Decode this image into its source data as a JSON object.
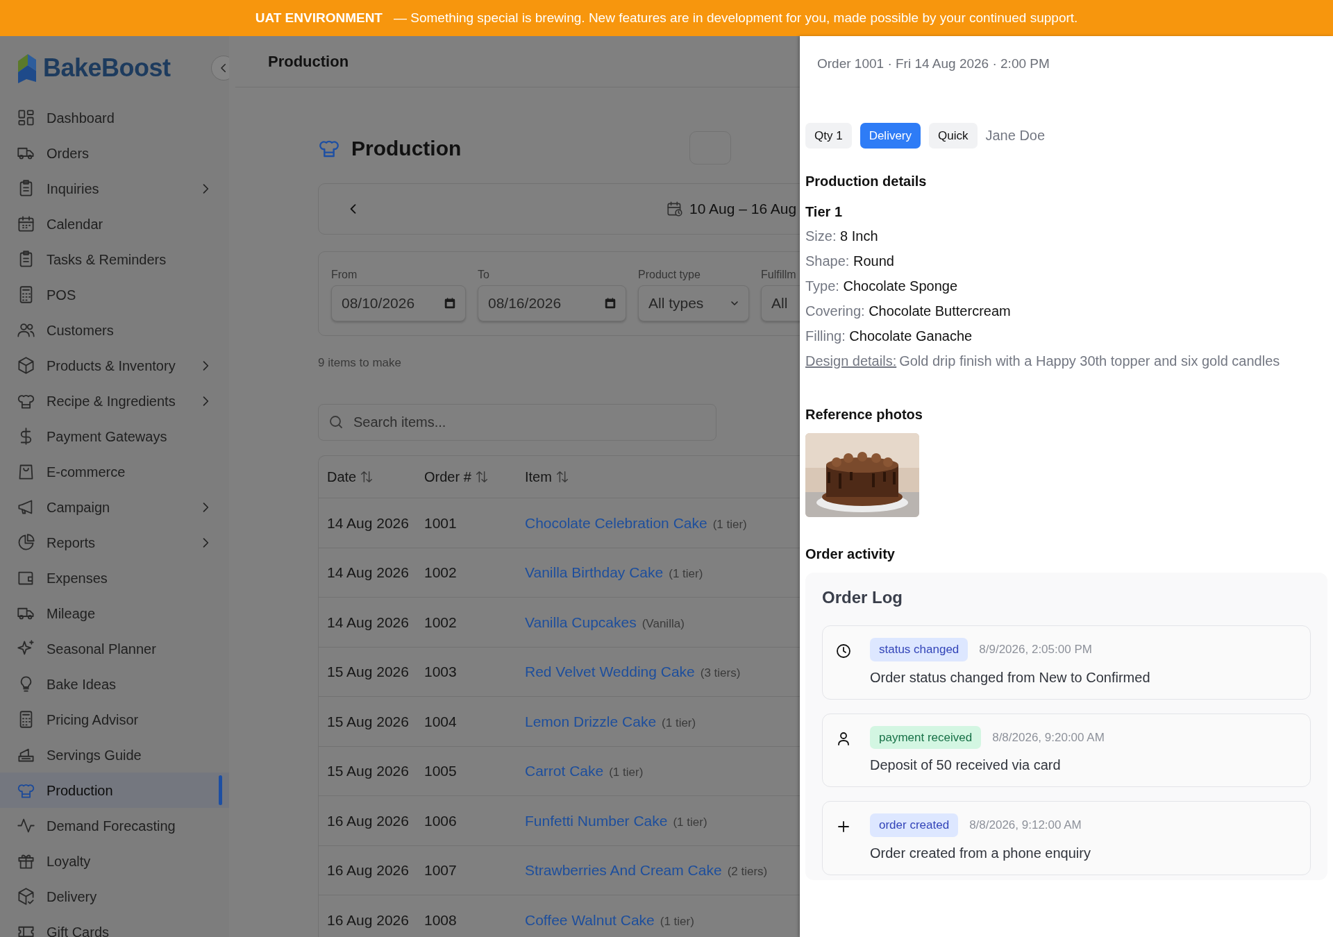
{
  "banner": {
    "label": "UAT ENVIRONMENT",
    "message": "— Something special is brewing. New features are in development for you, made possible by your continued support."
  },
  "sidebar": {
    "brand": "BakeBoost",
    "items": [
      {
        "label": "Dashboard",
        "expandable": false,
        "selected": false
      },
      {
        "label": "Orders",
        "expandable": false,
        "selected": false
      },
      {
        "label": "Inquiries",
        "expandable": true,
        "selected": false
      },
      {
        "label": "Calendar",
        "expandable": false,
        "selected": false
      },
      {
        "label": "Tasks & Reminders",
        "expandable": false,
        "selected": false
      },
      {
        "label": "POS",
        "expandable": false,
        "selected": false
      },
      {
        "label": "Customers",
        "expandable": false,
        "selected": false
      },
      {
        "label": "Products & Inventory",
        "expandable": true,
        "selected": false
      },
      {
        "label": "Recipe & Ingredients",
        "expandable": true,
        "selected": false
      },
      {
        "label": "Payment Gateways",
        "expandable": false,
        "selected": false
      },
      {
        "label": "E-commerce",
        "expandable": false,
        "selected": false
      },
      {
        "label": "Campaign",
        "expandable": true,
        "selected": false
      },
      {
        "label": "Reports",
        "expandable": true,
        "selected": false
      },
      {
        "label": "Expenses",
        "expandable": false,
        "selected": false
      },
      {
        "label": "Mileage",
        "expandable": false,
        "selected": false
      },
      {
        "label": "Seasonal Planner",
        "expandable": false,
        "selected": false
      },
      {
        "label": "Bake Ideas",
        "expandable": false,
        "selected": false
      },
      {
        "label": "Pricing Advisor",
        "expandable": false,
        "selected": false
      },
      {
        "label": "Servings Guide",
        "expandable": false,
        "selected": false
      },
      {
        "label": "Production",
        "expandable": false,
        "selected": true
      },
      {
        "label": "Demand Forecasting",
        "expandable": false,
        "selected": false
      },
      {
        "label": "Loyalty",
        "expandable": false,
        "selected": false
      },
      {
        "label": "Delivery",
        "expandable": false,
        "selected": false
      },
      {
        "label": "Gift Cards",
        "expandable": false,
        "selected": false
      }
    ]
  },
  "header": {
    "title": "Production"
  },
  "page": {
    "title": "Production",
    "date_range": "10 Aug – 16 Aug",
    "filters": [
      {
        "label": "From",
        "value": "08/10/2026",
        "kind": "date"
      },
      {
        "label": "To",
        "value": "08/16/2026",
        "kind": "date"
      },
      {
        "label": "Product type",
        "value": "All types",
        "kind": "select"
      },
      {
        "label": "Fulfillm",
        "value": "All",
        "kind": "cut"
      }
    ],
    "count": "9 items to make",
    "search": {
      "placeholder": "Search items..."
    }
  },
  "table": {
    "columns": [
      "Date",
      "Order #",
      "Item"
    ],
    "rows": [
      {
        "date": "14 Aug 2026",
        "order": "1001",
        "item": "Chocolate Celebration Cake",
        "detail": "(1 tier)"
      },
      {
        "date": "14 Aug 2026",
        "order": "1002",
        "item": "Vanilla Birthday Cake",
        "detail": "(1 tier)"
      },
      {
        "date": "14 Aug 2026",
        "order": "1002",
        "item": "Vanilla Cupcakes",
        "detail": "(Vanilla)"
      },
      {
        "date": "15 Aug 2026",
        "order": "1003",
        "item": "Red Velvet Wedding Cake",
        "detail": "(3 tiers)"
      },
      {
        "date": "15 Aug 2026",
        "order": "1004",
        "item": "Lemon Drizzle Cake",
        "detail": "(1 tier)"
      },
      {
        "date": "15 Aug 2026",
        "order": "1005",
        "item": "Carrot Cake",
        "detail": "(1 tier)"
      },
      {
        "date": "16 Aug 2026",
        "order": "1006",
        "item": "Funfetti Number Cake",
        "detail": "(1 tier)"
      },
      {
        "date": "16 Aug 2026",
        "order": "1007",
        "item": "Strawberries And Cream Cake",
        "detail": "(2 tiers)"
      },
      {
        "date": "16 Aug 2026",
        "order": "1008",
        "item": "Coffee Walnut Cake",
        "detail": "(1 tier)"
      }
    ]
  },
  "panel": {
    "title": "Order 1001 · Fri 14 Aug 2026 · 2:00 PM",
    "chips": [
      {
        "label": "Qty 1",
        "kind": "plain"
      },
      {
        "label": "Delivery",
        "kind": "primary"
      },
      {
        "label": "Quick",
        "kind": "plain"
      }
    ],
    "customer": "Jane Doe",
    "details_heading": "Production details",
    "tier": "Tier 1",
    "fields": [
      {
        "label": "Size:",
        "value": "8 Inch"
      },
      {
        "label": "Shape:",
        "value": "Round"
      },
      {
        "label": "Type:",
        "value": "Chocolate Sponge"
      },
      {
        "label": "Covering:",
        "value": "Chocolate Buttercream"
      },
      {
        "label": "Filling:",
        "value": "Chocolate Ganache"
      }
    ],
    "design": {
      "label": "Design details:",
      "value": "Gold drip finish with a Happy 30th topper and six gold candles"
    },
    "photos_heading": "Reference photos",
    "activity_heading": "Order activity",
    "log": {
      "title": "Order Log",
      "entries": [
        {
          "kind": "status",
          "tag": "status changed",
          "time": "8/9/2026, 2:05:00 PM",
          "text": "Order status changed from New to Confirmed"
        },
        {
          "kind": "payment",
          "tag": "payment received",
          "time": "8/8/2026, 9:20:00 AM",
          "text": "Deposit of 50 received via card"
        },
        {
          "kind": "created",
          "tag": "order created",
          "time": "8/8/2026, 9:12:00 AM",
          "text": "Order created from a phone enquiry"
        }
      ]
    }
  }
}
